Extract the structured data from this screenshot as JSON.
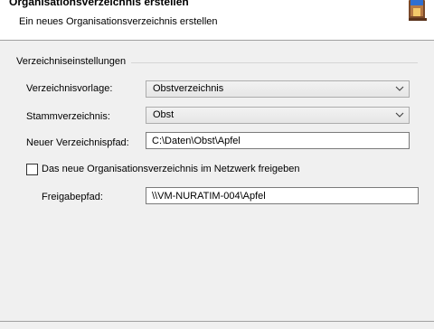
{
  "header": {
    "title": "Organisationsverzeichnis erstellen",
    "subtitle": "Ein neues Organisationsverzeichnis erstellen",
    "icon": "wizard-icon"
  },
  "settings": {
    "group_label": "Verzeichniseinstellungen",
    "template": {
      "label": "Verzeichnisvorlage:",
      "value": "Obstverzeichnis"
    },
    "root": {
      "label": "Stammverzeichnis:",
      "value": "Obst"
    },
    "new_path": {
      "label": "Neuer Verzeichnispfad:",
      "value": "C:\\Daten\\Obst\\Apfel"
    },
    "share": {
      "label": "Das neue Organisationsverzeichnis im Netzwerk freigeben",
      "checked": false
    },
    "share_path": {
      "label": "Freigabepfad:",
      "value": "\\\\VM-NURATIM-004\\Apfel"
    }
  }
}
